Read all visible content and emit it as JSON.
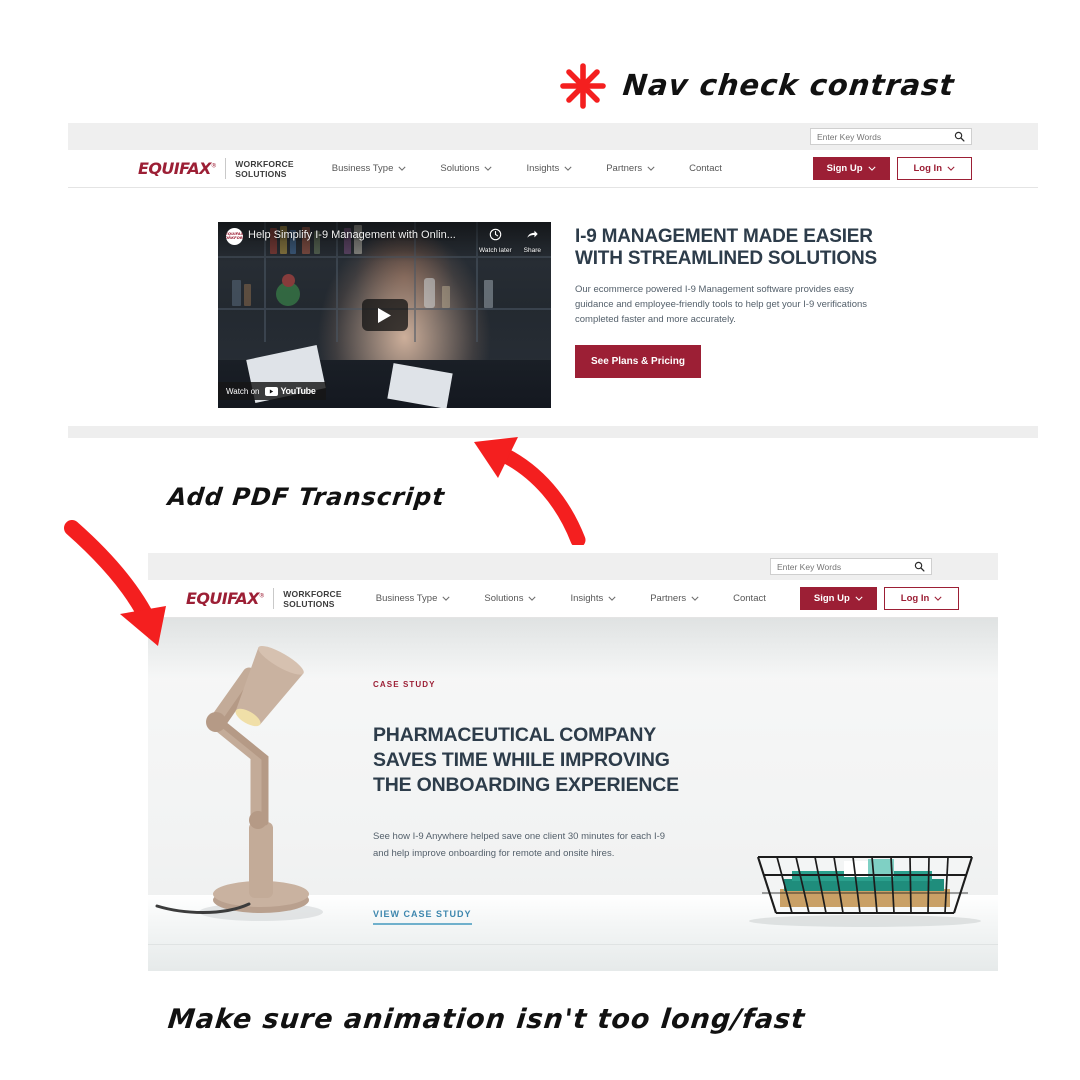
{
  "annotations": [
    {
      "id": "nav-contrast",
      "text": "Nav check contrast",
      "icon": "asterisk-star-icon",
      "color": "#f41f1f"
    },
    {
      "id": "pdf-transcript",
      "text": "Add PDF Transcript",
      "color": "#111111"
    },
    {
      "id": "animation-speed",
      "text": "Make sure animation isn't too long/fast",
      "color": "#111111"
    }
  ],
  "nav": {
    "brand": {
      "name": "EQUIFAX",
      "registered": "®",
      "sub_line_1": "WORKFORCE",
      "sub_line_2": "SOLUTIONS"
    },
    "links": [
      {
        "label": "Business Type",
        "has_caret": true
      },
      {
        "label": "Solutions",
        "has_caret": true
      },
      {
        "label": "Insights",
        "has_caret": true
      },
      {
        "label": "Partners",
        "has_caret": true
      },
      {
        "label": "Contact",
        "has_caret": false
      }
    ],
    "sign_up": "Sign Up",
    "log_in": "Log In",
    "search": {
      "placeholder": "Enter Key Words",
      "value": "",
      "icon": "search-icon"
    },
    "colors": {
      "brand_red": "#9c1f35",
      "utility_bar": "#efefef"
    }
  },
  "screenshot_one": {
    "video": {
      "title": "Help Simplify I-9 Management with Onlin...",
      "watch_later": "Watch later",
      "share": "Share",
      "watch_on": "Watch on",
      "platform": "YouTube",
      "play_icon": "play-button-icon"
    },
    "hero": {
      "title_line_1": "I-9 MANAGEMENT MADE EASIER",
      "title_line_2": "WITH STREAMLINED SOLUTIONS",
      "body": "Our ecommerce powered I-9 Management software provides easy guidance and employee-friendly tools to help get your I-9 verifications completed faster and more accurately.",
      "cta": "See Plans & Pricing"
    }
  },
  "screenshot_two": {
    "hero": {
      "eyebrow": "CASE STUDY",
      "title_line_1": "PHARMACEUTICAL COMPANY",
      "title_line_2": "SAVES TIME WHILE IMPROVING",
      "title_line_3": "THE ONBOARDING EXPERIENCE",
      "body": "See how I-9 Anywhere helped save one client 30 minutes for each I-9 and help improve onboarding for remote and onsite hires.",
      "link": "VIEW CASE STUDY",
      "link_color": "#3e87ae"
    }
  }
}
